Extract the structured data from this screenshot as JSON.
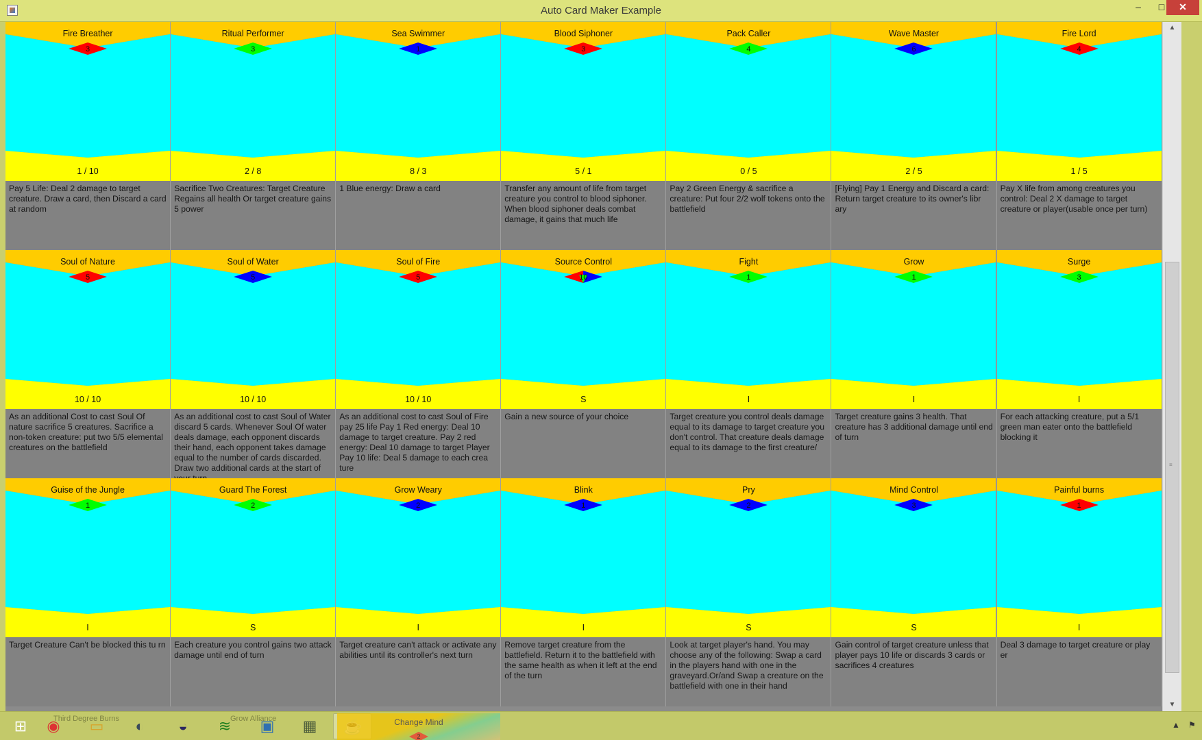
{
  "window": {
    "title": "Auto Card Maker Example",
    "minimize_glyph": "–",
    "maximize_glyph": "□",
    "close_glyph": "✕"
  },
  "colors": {
    "banner": "#ffcc00",
    "art": "#00ffff",
    "stats_band": "#ffff00",
    "text_panel": "#828282",
    "gem_red": "#ff0000",
    "gem_green": "#00ff00",
    "gem_blue": "#0000ff"
  },
  "cards": [
    {
      "name": "Fire Breather",
      "cost": "3",
      "gem": "red",
      "stats": "1 / 10",
      "text": "Pay 5 Life: Deal 2 damage to target creature. Draw a card, then Discard a card at random"
    },
    {
      "name": "Ritual Performer",
      "cost": "3",
      "gem": "green",
      "stats": "2 / 8",
      "text": "Sacrifice Two Creatures: Target Creature Regains all health Or target creature gains 5 power"
    },
    {
      "name": "Sea Swimmer",
      "cost": "1",
      "gem": "blue",
      "stats": "8 / 3",
      "text": "1 Blue energy: Draw a card"
    },
    {
      "name": "Blood Siphoner",
      "cost": "3",
      "gem": "red",
      "stats": "5 / 1",
      "text": "Transfer any amount of life from target creature you control to blood siphoner. When blood siphoner deals combat damage, it gains that much life"
    },
    {
      "name": "Pack Caller",
      "cost": "4",
      "gem": "green",
      "stats": "0 / 5",
      "text": "Pay 2 Green Energy & sacrifice a creature: Put four 2/2 wolf tokens onto the battlefield"
    },
    {
      "name": "Wave Master",
      "cost": "6",
      "gem": "blue",
      "stats": "2 / 5",
      "text": "[Flying] Pay 1 Energy and Discard a card: Return target creature to its owner's libr ary"
    },
    {
      "name": "Fire Lord",
      "cost": "4",
      "gem": "red",
      "stats": "1 / 5",
      "text": "Pay X life from among creatures you control: Deal 2 X damage to target creature or player(usable once per turn)"
    },
    {
      "name": "Soul of Nature",
      "cost": "5",
      "gem": "red",
      "stats": "10 / 10",
      "text": "As an additional Cost to cast Soul Of nature sacrifice 5 creatures. Sacrifice a non-token creature: put two 5/5 elemental creatures on the battlefield"
    },
    {
      "name": "Soul of Water",
      "cost": "5",
      "gem": "blue",
      "stats": "10 / 10",
      "text": "As an additional cost to cast Soul of Water discard 5 cards. Whenever Soul Of water deals damage, each opponent discards their hand, each opponent takes damage equal to the number of cards discarded. Draw two additional cards at the start of your turn"
    },
    {
      "name": "Soul of Fire",
      "cost": "5",
      "gem": "red",
      "stats": "10 / 10",
      "text": "As an additional cost to cast Soul of Fire pay 25 life Pay 1 Red energy: Deal 10 damage to target creature. Pay 2 red energy: Deal 10 damage to target Player Pay 10 life: Deal 5 damage to each crea ture"
    },
    {
      "name": "Source Control",
      "cost": "10",
      "gem": "multi",
      "stats": "S",
      "text": "Gain a new source of your choice"
    },
    {
      "name": "Fight",
      "cost": "1",
      "gem": "green",
      "stats": "I",
      "text": "Target creature you control deals damage equal to its damage to target creature you don't control. That creature deals damage equal to its damage to the first creature/"
    },
    {
      "name": "Grow",
      "cost": "1",
      "gem": "green",
      "stats": "I",
      "text": "Target creature gains 3 health. That creature has 3 additional damage until end of turn"
    },
    {
      "name": "Surge",
      "cost": "3",
      "gem": "green",
      "stats": "I",
      "text": "For each attacking creature, put a 5/1 green man eater onto the battlefield blocking it"
    },
    {
      "name": "Guise of the Jungle",
      "cost": "1",
      "gem": "green",
      "stats": "I",
      "text": "Target Creature Can't be blocked this tu rn"
    },
    {
      "name": "Guard The Forest",
      "cost": "2",
      "gem": "green",
      "stats": "S",
      "text": "Each creature you control gains two attack damage until end of turn"
    },
    {
      "name": "Grow Weary",
      "cost": "2",
      "gem": "blue",
      "stats": "I",
      "text": "Target creature can't attack or activate any abilities until its controller's next turn"
    },
    {
      "name": "Blink",
      "cost": "1",
      "gem": "blue",
      "stats": "I",
      "text": "Remove target creature from the battlefield. Return it to the battlefield with the same health as when it left at the end of the turn"
    },
    {
      "name": "Pry",
      "cost": "2",
      "gem": "blue",
      "stats": "S",
      "text": "Look at target player's hand. You may choose any of the following: Swap a card in the players hand with one in the graveyard.Or/and Swap a creature on the battlefield with one in their hand"
    },
    {
      "name": "Mind Control",
      "cost": "3",
      "gem": "blue",
      "stats": "S",
      "text": "Gain control of target creature unless that player pays 10 life or discards 3 cards or sacrifices 4 creatures"
    },
    {
      "name": "Painful burns",
      "cost": "1",
      "gem": "red",
      "stats": "I",
      "text": "Deal 3 damage to target creature or play er"
    }
  ],
  "scrollbar": {
    "up_arrow": "▲",
    "down_arrow": "▼",
    "grip": "≡"
  },
  "taskbar": {
    "items": [
      {
        "name": "windows-start-icon",
        "glyph": "⊞"
      },
      {
        "name": "chrome-icon",
        "glyph": "◉"
      },
      {
        "name": "file-explorer-icon",
        "glyph": "▭"
      },
      {
        "name": "media-player-icon",
        "glyph": "◐"
      },
      {
        "name": "eclipse-icon",
        "glyph": "◒"
      },
      {
        "name": "spotify-icon",
        "glyph": "≋"
      },
      {
        "name": "photo-viewer-icon",
        "glyph": "▣"
      },
      {
        "name": "spreadsheet-icon",
        "glyph": "▦"
      },
      {
        "name": "java-icon",
        "glyph": "☕"
      }
    ],
    "ghost_labels": [
      "Third Degree Burns",
      "Grow Alliance"
    ],
    "peek_card": {
      "name": "Change Mind",
      "cost": "2"
    },
    "tray_arrow": "▲",
    "tray_flag": "⚑"
  }
}
